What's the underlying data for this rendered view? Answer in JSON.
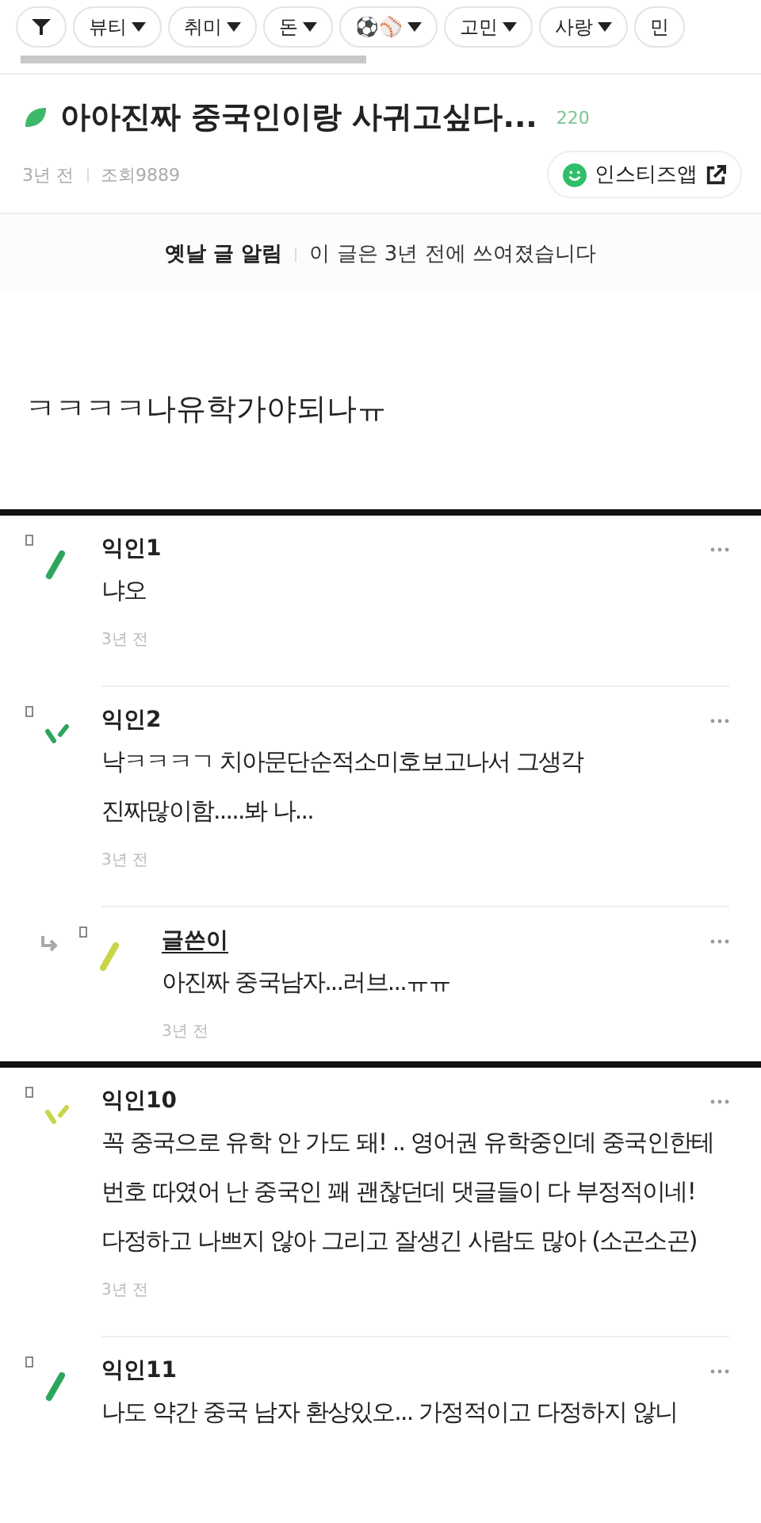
{
  "category_chips": [
    {
      "kind": "icon"
    },
    {
      "kind": "text",
      "label": "뷰티"
    },
    {
      "kind": "text",
      "label": "취미"
    },
    {
      "kind": "text",
      "label": "돈"
    },
    {
      "kind": "emoji",
      "label": "⚽⚾"
    },
    {
      "kind": "text",
      "label": "고민"
    },
    {
      "kind": "text",
      "label": "사랑"
    },
    {
      "kind": "cut",
      "label": "민"
    }
  ],
  "post": {
    "title": "아아진짜 중국인이랑 사귀고싶다...",
    "comment_count": "220",
    "time": "3년 전",
    "views": "조회9889",
    "app_button": "인스티즈앱",
    "notice_label": "옛날 글 알림",
    "notice_text": "이 글은 3년 전에 쓰여졌습니다",
    "body": "ㅋㅋㅋㅋ나유학가야되나ㅠ"
  },
  "sections": [
    [
      {
        "kind": "comment",
        "author": "익인1",
        "is_writer": false,
        "body": "냐오",
        "time": "3년 전",
        "color": "#2ea55c"
      },
      {
        "kind": "comment",
        "author": "익인2",
        "is_writer": false,
        "body": "낙ㅋㅋㅋㄱ 치아문단순적소미호보고나서 그생각 진짜많이함.....봐 나...",
        "time": "3년 전",
        "color": "#2ea55c"
      },
      {
        "kind": "reply",
        "author": "글쓴이",
        "is_writer": true,
        "body": "아진짜 중국남자...러브...ㅠㅠ",
        "time": "3년 전",
        "color": "#c9d447"
      }
    ],
    [
      {
        "kind": "comment",
        "author": "익인10",
        "is_writer": false,
        "body": "꼭 중국으로 유학 안 가도 돼! .. 영어권 유학중인데 중국인한테 번호 따였어 난 중국인 꽤 괜찮던데 댓글들이 다 부정적이네! 다정하고 나쁘지 않아 그리고 잘생긴 사람도 많아 (소곤소곤)",
        "time": "3년 전",
        "color": "#c9d447"
      },
      {
        "kind": "comment",
        "author": "익인11",
        "is_writer": false,
        "body": "나도 약간 중국 남자 환상있오... 가정적이고 다정하지 않니",
        "color": "#2ea55c"
      }
    ]
  ]
}
